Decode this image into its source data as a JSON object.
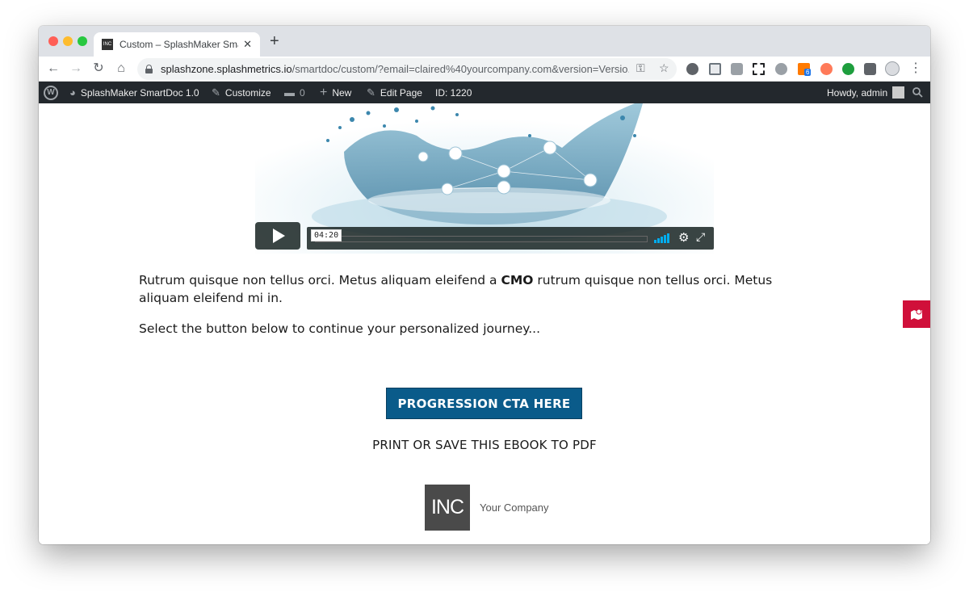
{
  "browser": {
    "tab_title": "Custom – SplashMaker SmartD",
    "tab_favicon_text": "INC",
    "url_host": "splashzone.splashmetrics.io",
    "url_path": "/smartdoc/custom/?email=claired%40yourcompany.com&version=Versio...",
    "extension_badge": "6"
  },
  "adminbar": {
    "site_name": "SplashMaker SmartDoc 1.0",
    "customize": "Customize",
    "comments_count": "0",
    "new": "New",
    "edit_page": "Edit Page",
    "page_id": "ID: 1220",
    "howdy": "Howdy, admin"
  },
  "video": {
    "timecode": "04:20"
  },
  "content": {
    "paragraph1_before": "Rutrum quisque non tellus orci. Metus aliquam eleifend a ",
    "paragraph1_bold": "CMO",
    "paragraph1_after": " rutrum quisque non tellus orci. Metus aliquam eleifend mi in.",
    "paragraph2": "Select the button below to continue your personalized journey...",
    "cta_label": "PROGRESSION CTA HERE",
    "print_link": "PRINT OR SAVE THIS EBOOK TO PDF"
  },
  "footer": {
    "logo_text": "INC",
    "company_name": "Your Company"
  },
  "colors": {
    "cta_bg": "#0a5b8a",
    "side_tab_bg": "#d0103a",
    "admin_bar_bg": "#23282d"
  }
}
